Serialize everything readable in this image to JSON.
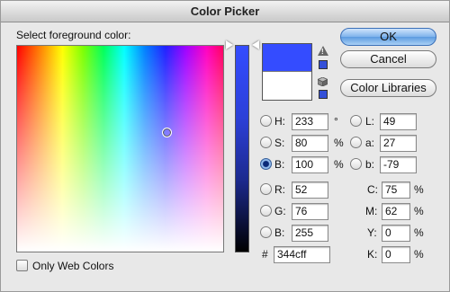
{
  "window": {
    "title": "Color Picker"
  },
  "heading": "Select foreground color:",
  "colors": {
    "new": "#344cff",
    "old": "#ffffff",
    "accent": "#5c9be0"
  },
  "buttons": {
    "ok": "OK",
    "cancel": "Cancel",
    "libraries": "Color Libraries"
  },
  "hsb": {
    "h": {
      "label": "H:",
      "value": "233",
      "unit": "°"
    },
    "s": {
      "label": "S:",
      "value": "80",
      "unit": "%"
    },
    "b": {
      "label": "B:",
      "value": "100",
      "unit": "%"
    },
    "selected": "B"
  },
  "rgb": {
    "r": {
      "label": "R:",
      "value": "52"
    },
    "g": {
      "label": "G:",
      "value": "76"
    },
    "b": {
      "label": "B:",
      "value": "255"
    }
  },
  "lab": {
    "l": {
      "label": "L:",
      "value": "49"
    },
    "a": {
      "label": "a:",
      "value": "27"
    },
    "b": {
      "label": "b:",
      "value": "-79"
    }
  },
  "cmyk": {
    "c": {
      "label": "C:",
      "value": "75",
      "unit": "%"
    },
    "m": {
      "label": "M:",
      "value": "62",
      "unit": "%"
    },
    "y": {
      "label": "Y:",
      "value": "0",
      "unit": "%"
    },
    "k": {
      "label": "K:",
      "value": "0",
      "unit": "%"
    }
  },
  "hex": {
    "label": "#",
    "value": "344cff"
  },
  "web_only": {
    "label": "Only Web Colors",
    "checked": false
  },
  "icons": {
    "gamut_warning": "warning-triangle-icon",
    "web_safe": "cube-icon"
  }
}
